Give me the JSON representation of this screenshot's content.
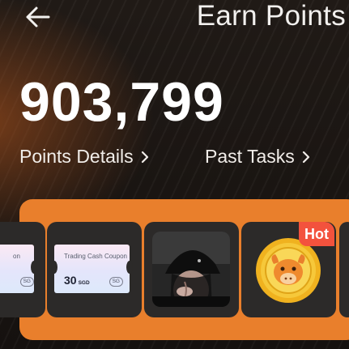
{
  "header": {
    "title": "Earn Points",
    "back_icon": "arrow-left-icon"
  },
  "points": {
    "value": "903,799"
  },
  "links": {
    "details": "Points Details",
    "past": "Past Tasks",
    "chevron": "›"
  },
  "colors": {
    "accent": "#e97f2c",
    "hot": "#f3523d",
    "card": "#2c2a29"
  },
  "rewards": {
    "partial_coupon": {
      "title": "on",
      "badge": "SG"
    },
    "coupon": {
      "title": "Trading Cash Coupon",
      "amount": "30",
      "currency": "SGD",
      "badge": "SG"
    },
    "hot_badge": "Hot"
  }
}
